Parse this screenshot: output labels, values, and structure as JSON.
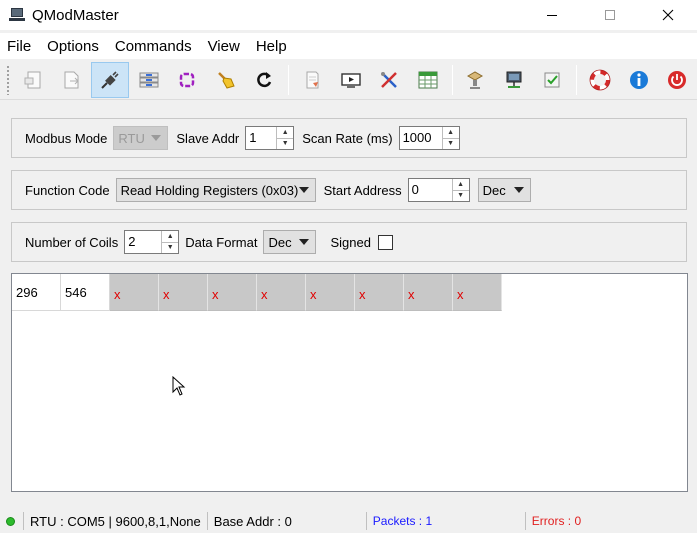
{
  "window": {
    "title": "QModMaster",
    "controls": [
      "minimize-icon",
      "maximize-icon",
      "close-icon"
    ]
  },
  "menu": [
    "File",
    "Options",
    "Commands",
    "View",
    "Help"
  ],
  "toolbar": {
    "groups": [
      [
        "new-icon",
        "export-icon",
        "connect-icon",
        "bus-monitor-icon",
        "loop-icon",
        "clear-icon",
        "refresh-icon"
      ],
      [
        "log-icon",
        "monitor-icon",
        "tools-icon",
        "table-icon"
      ],
      [
        "network-icon",
        "server-icon",
        "checkbox-icon"
      ],
      [
        "help-icon",
        "info-icon",
        "exit-icon"
      ]
    ],
    "active": "connect-icon"
  },
  "panel1": {
    "modbus_mode_label": "Modbus Mode",
    "modbus_mode_value": "RTU",
    "slave_addr_label": "Slave Addr",
    "slave_addr_value": "1",
    "scan_rate_label": "Scan Rate (ms)",
    "scan_rate_value": "1000"
  },
  "panel2": {
    "function_code_label": "Function Code",
    "function_code_value": "Read Holding Registers (0x03)",
    "start_address_label": "Start Address",
    "start_address_value": "0",
    "base_value": "Dec"
  },
  "panel3": {
    "num_coils_label": "Number of Coils",
    "num_coils_value": "2",
    "data_format_label": "Data Format",
    "data_format_value": "Dec",
    "signed_label": "Signed",
    "signed_checked": false
  },
  "registers": [
    "296",
    "546",
    "x",
    "x",
    "x",
    "x",
    "x",
    "x",
    "x",
    "x"
  ],
  "status": {
    "connection": "RTU : COM5 | 9600,8,1,None",
    "base_addr": "Base Addr : 0",
    "packets": "Packets : 1",
    "errors": "Errors : 0",
    "packets_color": "#1a1aff",
    "errors_color": "#e02020"
  }
}
